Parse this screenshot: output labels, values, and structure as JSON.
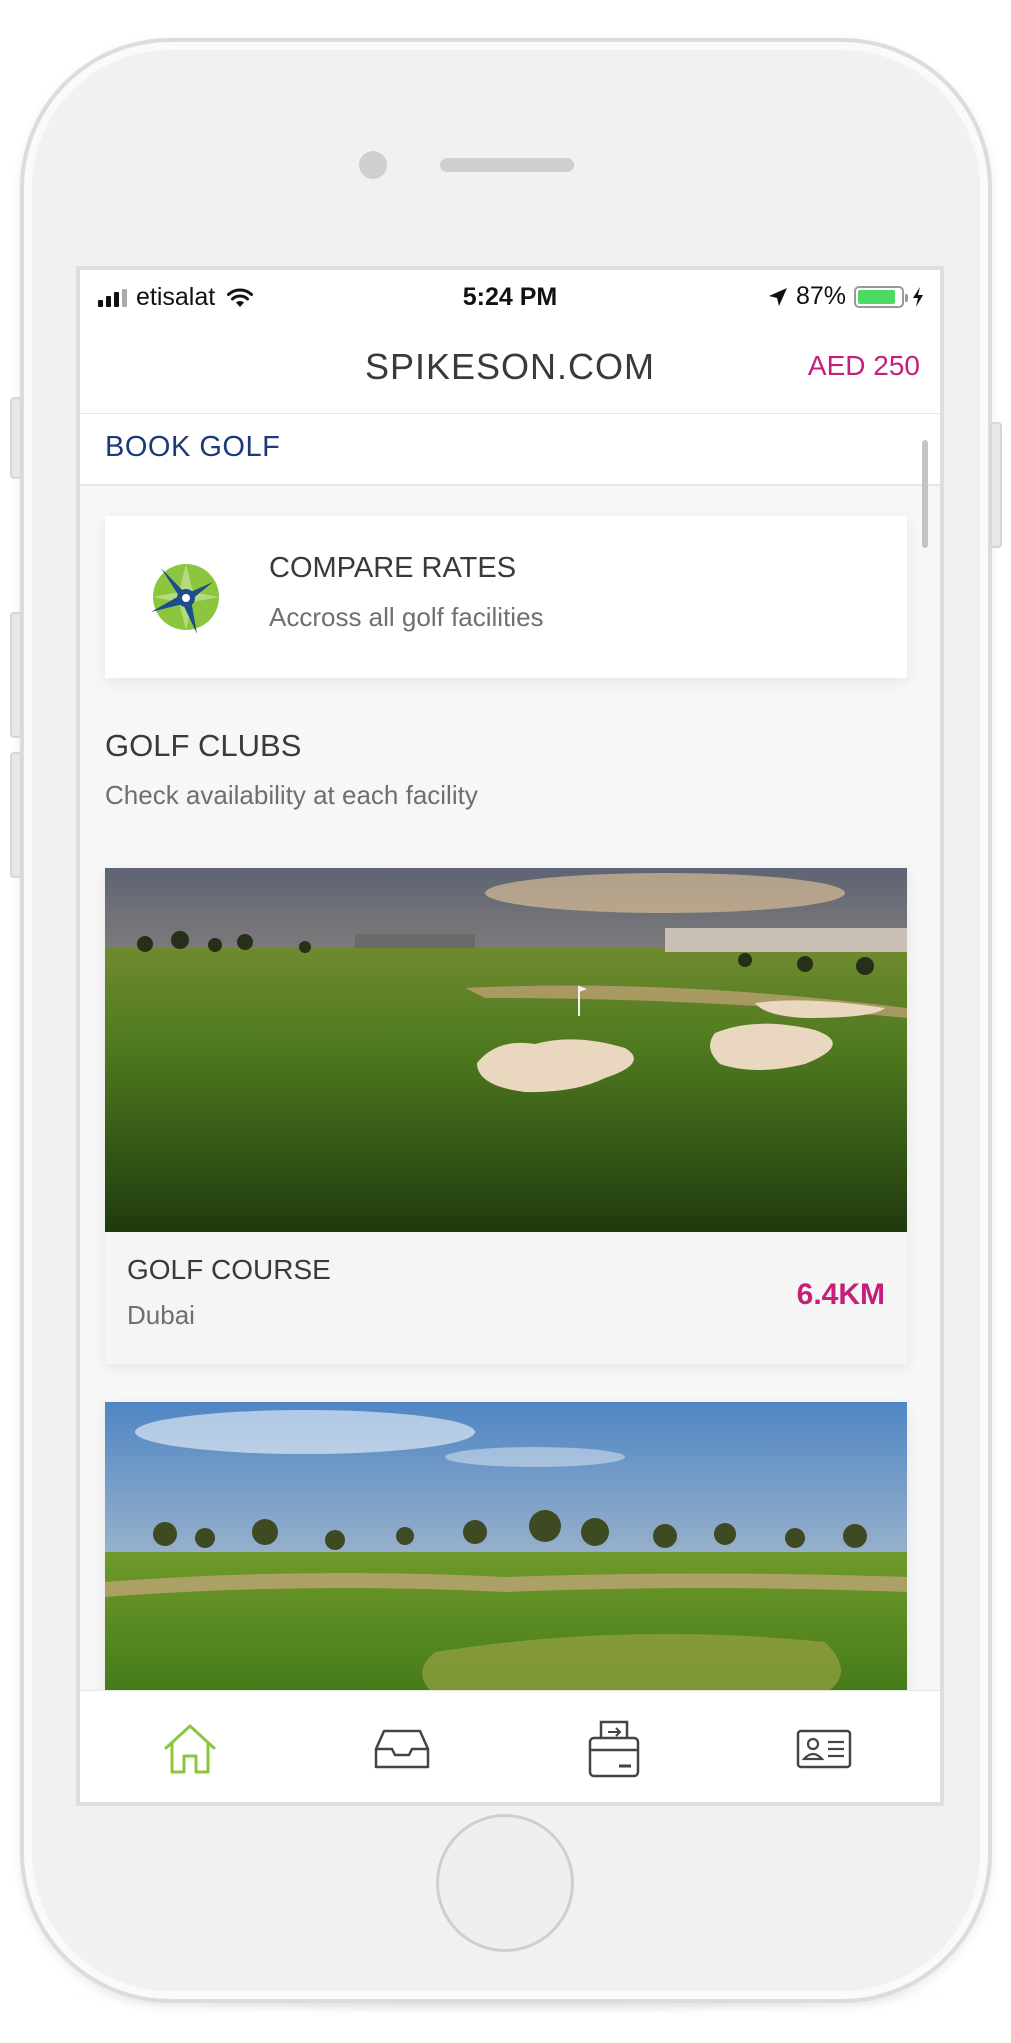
{
  "status_bar": {
    "carrier": "etisalat",
    "time": "5:24 PM",
    "battery_percent": "87%",
    "battery_level": 0.87,
    "battery_color": "#4cd964",
    "icons": [
      "signal-icon",
      "wifi-icon",
      "location-arrow-icon",
      "battery-icon",
      "charging-icon"
    ]
  },
  "nav": {
    "title": "SPIKESON.COM",
    "balance": "AED 250"
  },
  "section_tab": {
    "label": "BOOK GOLF"
  },
  "compare": {
    "title": "COMPARE RATES",
    "subtitle": "Accross all golf facilities",
    "icon": "spikeson-logo-icon"
  },
  "golf_clubs": {
    "title": "GOLF CLUBS",
    "subtitle": "Check availability at each facility"
  },
  "facilities": [
    {
      "name": "GOLF COURSE",
      "city": "Dubai",
      "distance": "6.4KM"
    },
    {
      "name": "",
      "city": "",
      "distance": ""
    }
  ],
  "tab_bar": {
    "items": [
      {
        "icon": "home-icon",
        "active": true
      },
      {
        "icon": "inbox-icon",
        "active": false
      },
      {
        "icon": "wallet-icon",
        "active": false
      },
      {
        "icon": "id-card-icon",
        "active": false
      }
    ]
  },
  "colors": {
    "accent_magenta": "#c51f7b",
    "navy": "#1c3a75",
    "active_green": "#8cc63f",
    "logo_green": "#8cc63f",
    "logo_blue": "#1c4d8c"
  }
}
